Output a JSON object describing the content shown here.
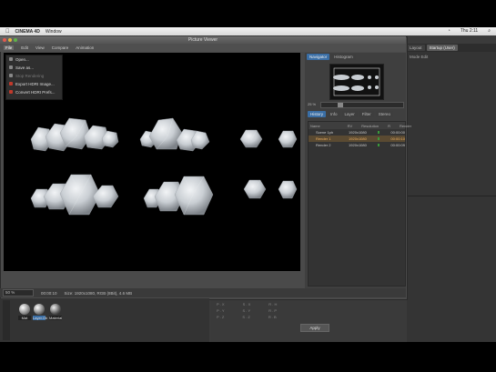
{
  "menubar": {
    "app_name": "CINEMA 4D",
    "window_menu": "Window",
    "clock": "Thu 2:11"
  },
  "picture_viewer": {
    "title": "Picture Viewer",
    "menu": [
      "File",
      "Edit",
      "View",
      "Compare",
      "Animation"
    ],
    "file_menu_items": [
      {
        "label": "Open...",
        "enabled": true
      },
      {
        "label": "Save as...",
        "enabled": true
      },
      {
        "label": "Stop Rendering",
        "enabled": false
      },
      {
        "label": "Export HDRI Image...",
        "enabled": true
      },
      {
        "label": "Convert HDRI Prefs...",
        "enabled": true
      }
    ],
    "status": {
      "zoom": "50 %",
      "time": "00:00:10",
      "size": "Size: 1920x1080, RGB (8Bit), 4.6 MB"
    },
    "side_tabs": [
      "Navigator",
      "Histogram"
    ],
    "zoom_value": "25 %",
    "info_tabs": [
      "History",
      "Info",
      "Layer",
      "Filter",
      "Stereo"
    ],
    "layers": {
      "header": [
        "Name",
        "RV",
        "Resolution",
        "R",
        "Render"
      ],
      "rows": [
        {
          "name": "Scene 1ph",
          "res": "1920x1080",
          "time": "00:00:00",
          "selected": false
        },
        {
          "name": "Render 1",
          "res": "1920x1080",
          "time": "00:00:10",
          "selected": true
        },
        {
          "name": "Render 2",
          "res": "1920x1080",
          "time": "00:00:09",
          "selected": false
        }
      ]
    }
  },
  "right_panel": {
    "tabs": [
      "Layout",
      "Startup (User)"
    ],
    "sub": "Mode  Edit"
  },
  "attributes": {
    "rows": [
      "P . X",
      "S . X",
      "R . H",
      "P . Y",
      "S . Y",
      "R . P",
      "P . Z",
      "S . Z",
      "R . B"
    ],
    "apply_label": "Apply"
  },
  "materials": [
    {
      "label": "Mat",
      "selected": false
    },
    {
      "label": "Layer.Ob",
      "selected": true
    },
    {
      "label": "Material",
      "selected": false
    }
  ],
  "colors": {
    "accent_tab": "#3a6ea5",
    "selection": "#5a4a32",
    "render_bg": "#000000"
  }
}
